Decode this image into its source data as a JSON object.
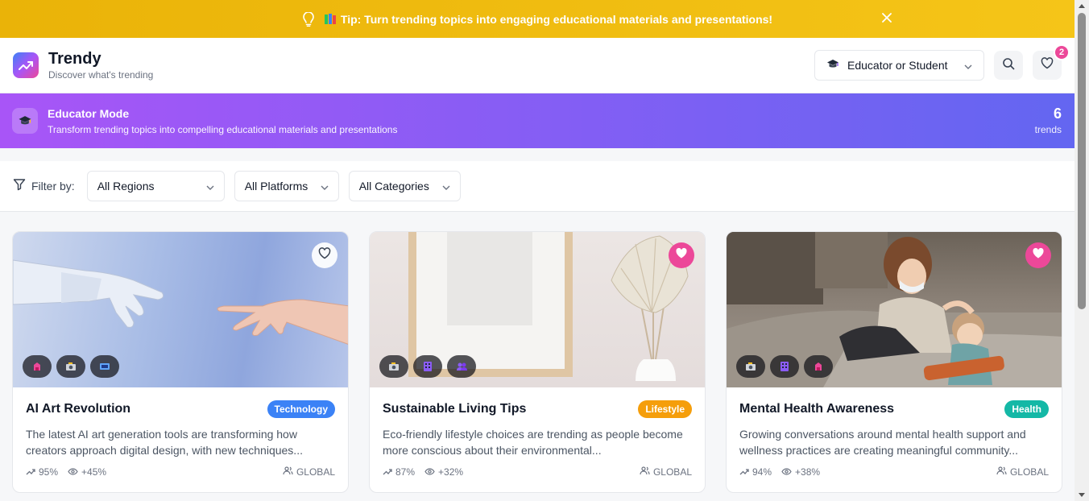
{
  "tip": {
    "text": "Tip: Turn trending topics into engaging educational materials and presentations!",
    "icon": "lightbulb-icon"
  },
  "header": {
    "app_name": "Trendy",
    "tagline": "Discover what's trending",
    "role_select": "Educator or Student",
    "favorites_count": "2"
  },
  "mode_banner": {
    "title": "Educator Mode",
    "subtitle": "Transform trending topics into compelling educational materials and presentations",
    "count": "6",
    "count_label": "trends"
  },
  "filters": {
    "label": "Filter by:",
    "region": "All Regions",
    "platform": "All Platforms",
    "category": "All Categories"
  },
  "colors": {
    "technology": "#3b82f6",
    "lifestyle": "#f59e0b",
    "health": "#14b8a6",
    "accent_pink": "#ec4899",
    "tip_yellow": "#eab308"
  },
  "cards": [
    {
      "title": "AI Art Revolution",
      "category": "Technology",
      "description": "The latest AI art generation tools are transforming how creators approach digital design, with new techniques...",
      "growth": "95%",
      "views": "+45%",
      "region": "GLOBAL",
      "favorited": false,
      "platforms": [
        "tiktok-icon",
        "instagram-icon",
        "youtube-icon"
      ]
    },
    {
      "title": "Sustainable Living Tips",
      "category": "Lifestyle",
      "description": "Eco-friendly lifestyle choices are trending as people become more conscious about their environmental...",
      "growth": "87%",
      "views": "+32%",
      "region": "GLOBAL",
      "favorited": true,
      "platforms": [
        "instagram-icon",
        "pinterest-icon",
        "facebook-icon"
      ]
    },
    {
      "title": "Mental Health Awareness",
      "category": "Health",
      "description": "Growing conversations around mental health support and wellness practices are creating meaningful community...",
      "growth": "94%",
      "views": "+38%",
      "region": "GLOBAL",
      "favorited": true,
      "platforms": [
        "instagram-icon",
        "pinterest-icon",
        "tiktok-icon"
      ]
    }
  ]
}
